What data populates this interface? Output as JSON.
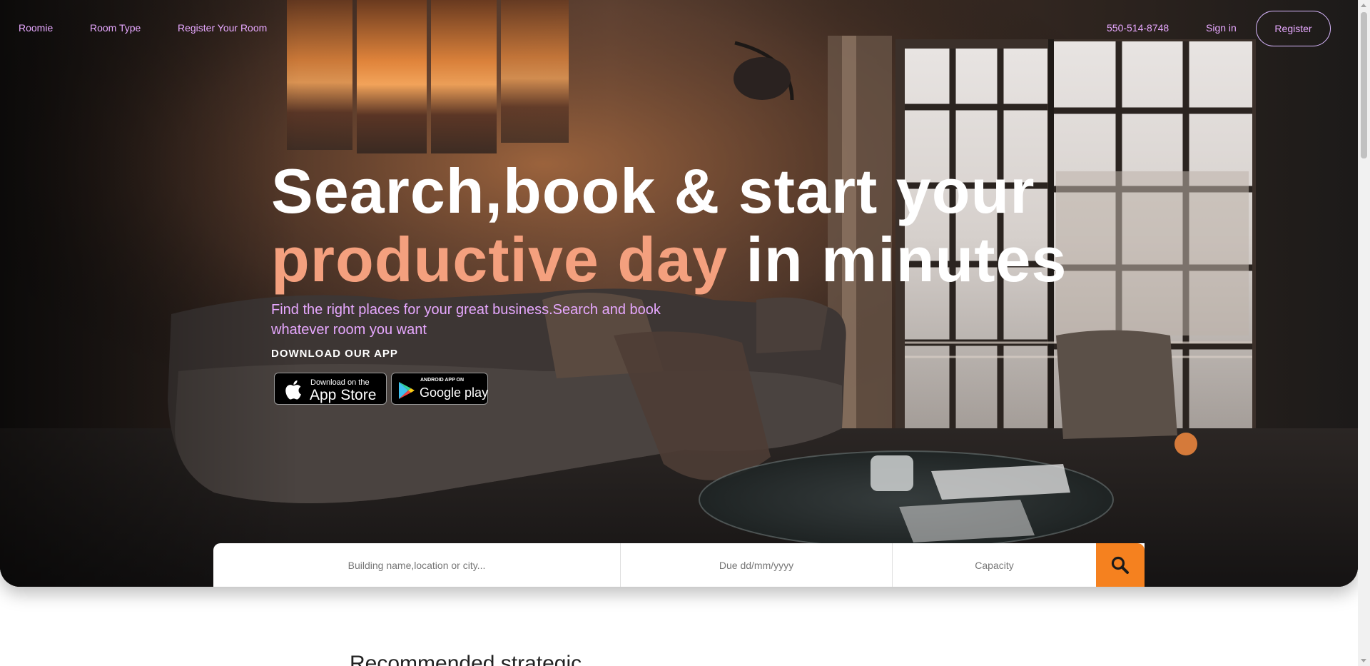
{
  "nav": {
    "brand": "Roomie",
    "room_type": "Room Type",
    "register_room": "Register Your Room",
    "phone": "550-514-8748",
    "sign_in": "Sign in",
    "register": "Register"
  },
  "hero": {
    "line1": "Search,book & start your",
    "line2_accent": "productive day",
    "line2_rest": "in minutes",
    "subtext": "Find the right places for your great business.Search and book whatever room you want",
    "download_label": "DOWNLOAD OUR APP",
    "app_store": {
      "small": "Download on the",
      "big": "App Store"
    },
    "google_play": {
      "small": "ANDROID APP ON",
      "big": "Google play"
    }
  },
  "search": {
    "location_placeholder": "Building name,location or city...",
    "date_placeholder": "Due dd/mm/yyyy",
    "capacity_placeholder": "Capacity"
  },
  "section": {
    "heading": "Recommended strategic"
  },
  "colors": {
    "accent_orange": "#f5811f",
    "headline_accent": "#f4a07e",
    "nav_link": "#e7a8ff"
  }
}
